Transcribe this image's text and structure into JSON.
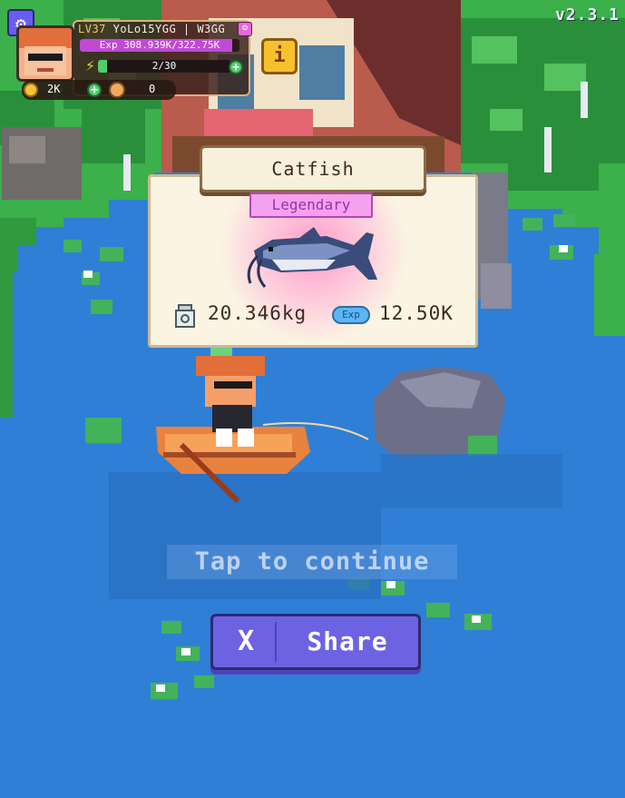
{
  "version": "v2.3.1",
  "player": {
    "level": "LV37",
    "name": "YoLo15YGG | W3GG",
    "exp_text": "Exp  308.939K/322.75K",
    "exp_fraction": 0.957,
    "energy_text": "2/30",
    "energy_fraction": 0.067,
    "coins": "2K",
    "shells": "0"
  },
  "catch": {
    "fish_name": "Catfish",
    "rarity": "Legendary",
    "weight": "20.346kg",
    "exp_badge": "Exp",
    "exp_value": "12.50K"
  },
  "prompt": {
    "tap_to_continue": "Tap to continue"
  },
  "share": {
    "icon_text": "X",
    "label": "Share"
  },
  "colors": {
    "water": "#2f7fd6",
    "grass": "#3cb04a",
    "accent": "#6c63e3",
    "legendary": "#f5a2ee"
  }
}
